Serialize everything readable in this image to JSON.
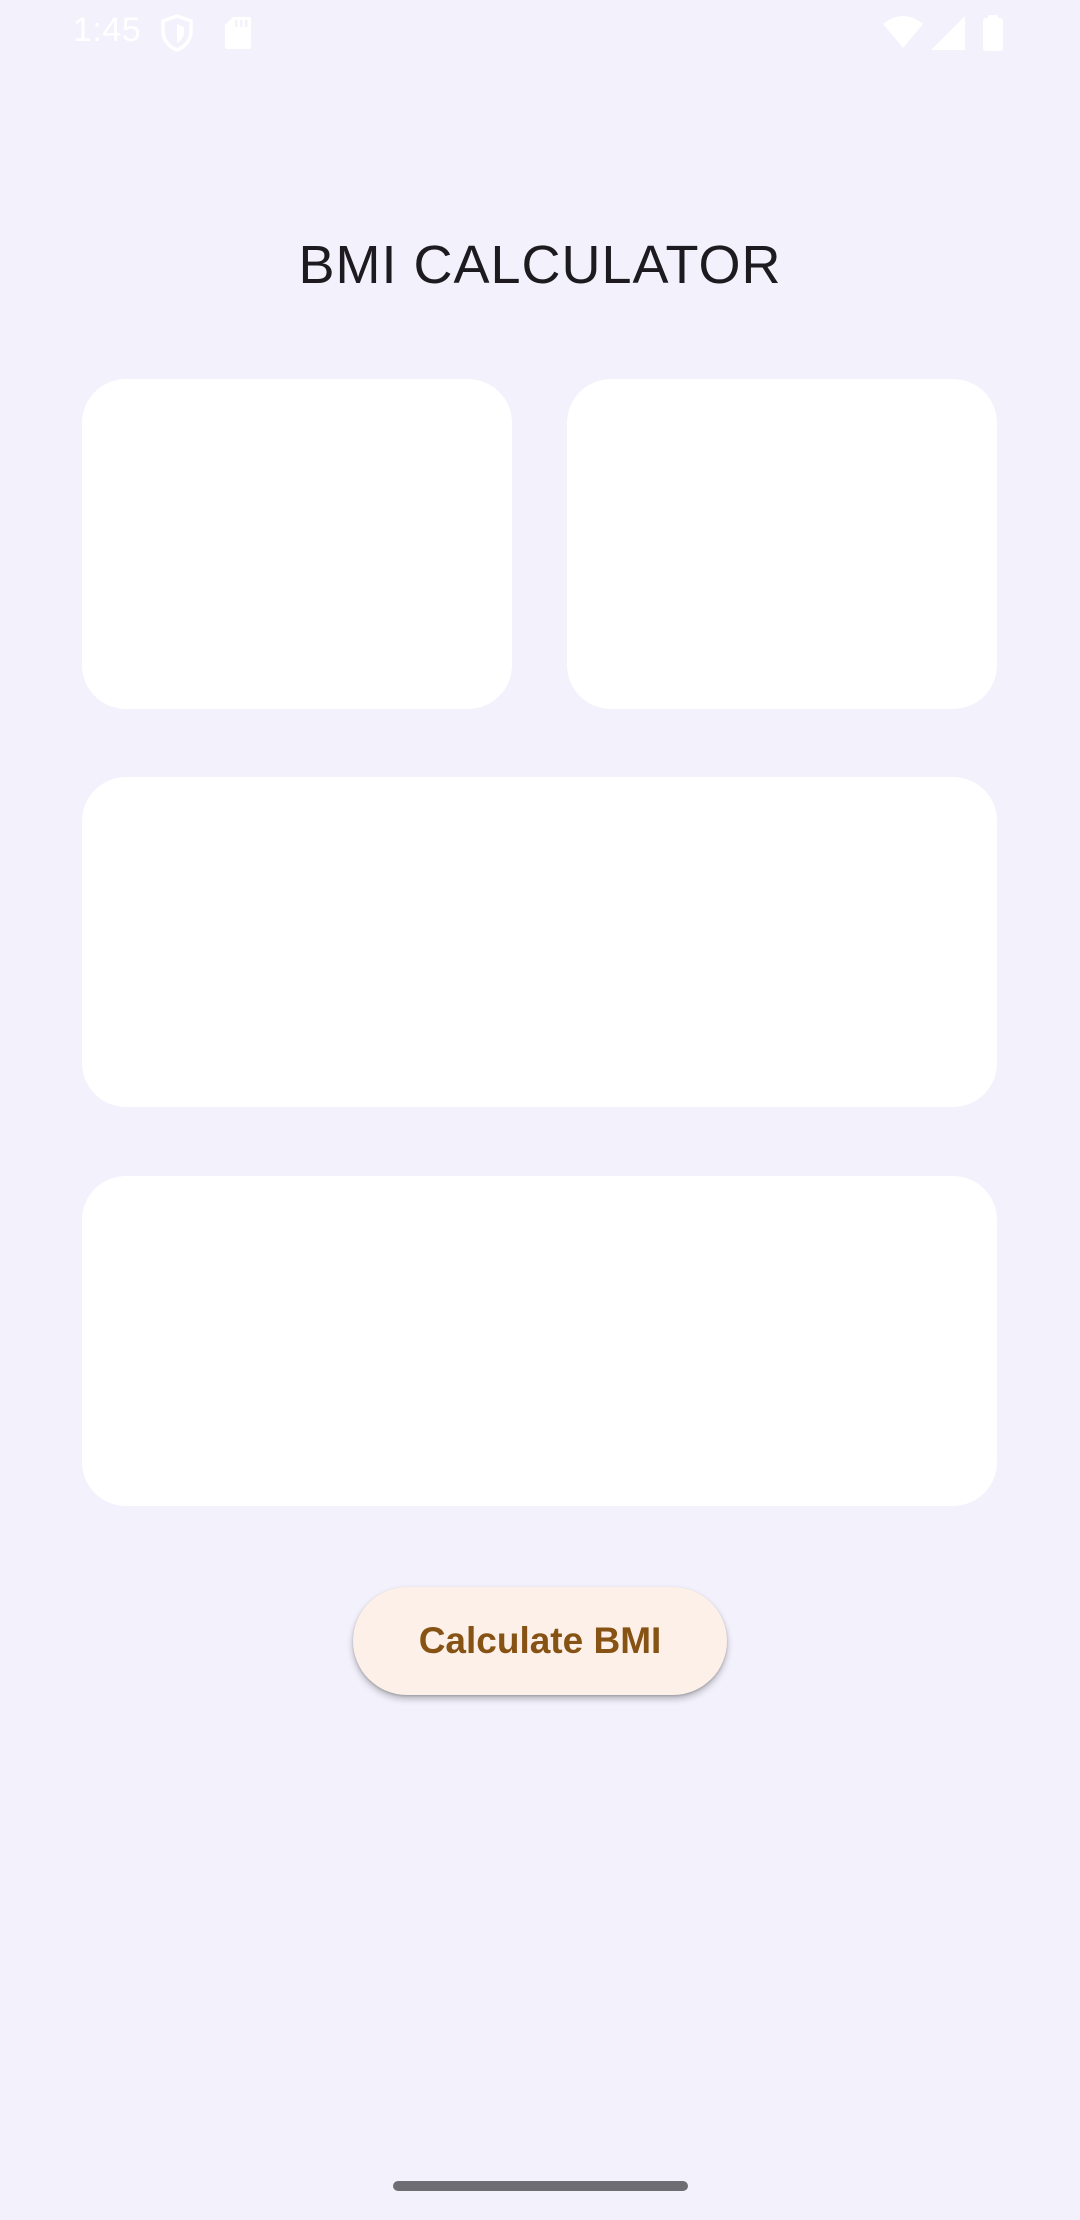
{
  "status_bar": {
    "time": "1:45",
    "icons": [
      "shield-icon",
      "sd-card-icon",
      "wifi-icon",
      "signal-icon",
      "battery-icon"
    ]
  },
  "app": {
    "title": "BMI CALCULATOR"
  },
  "actions": {
    "calculate_label": "Calculate BMI"
  },
  "colors": {
    "background": "#f3f1fc",
    "card": "#ffffff",
    "button_bg": "#fdf0e8",
    "button_text": "#865315",
    "title_text": "#1d1b20"
  }
}
